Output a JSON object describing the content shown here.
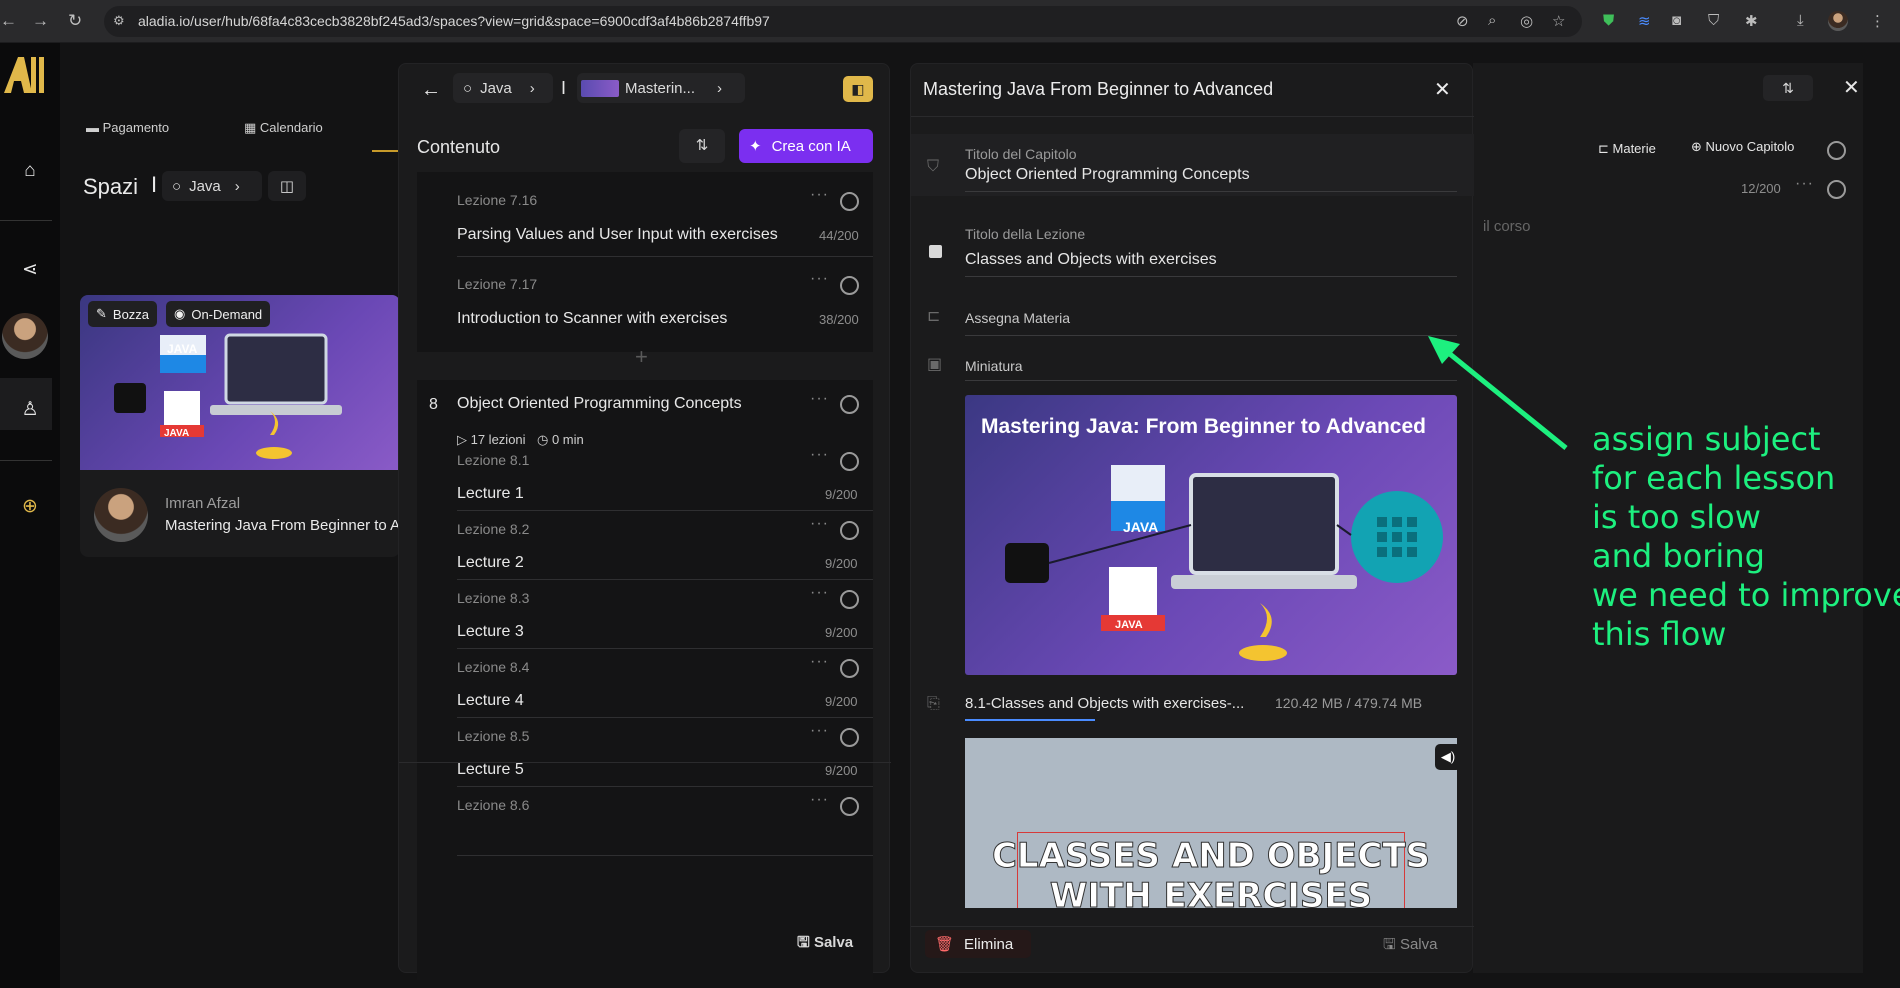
{
  "browser": {
    "url": "aladia.io/user/hub/68fa4c83cecb3828bf245ad3/spaces?view=grid&space=6900cdf3af4b86b2874ffb97"
  },
  "bg": {
    "tabs": [
      "Pagamento",
      "Calendario"
    ],
    "spazi_title": "Spazi",
    "spazi_crumb": "Java",
    "card": {
      "badge1": "Bozza",
      "badge2": "On-Demand",
      "thumb_label": "JAVA",
      "thumb_label2": "JAVA",
      "author": "Imran Afzal",
      "title": "Mastering Java From Beginner to A"
    }
  },
  "mid": {
    "crumb1": "Java",
    "crumb2": "Masterin...",
    "heading": "Contenuto",
    "ai_button": "Crea con IA",
    "lessons_top": [
      {
        "label": "Lezione 7.16",
        "title": "Parsing Values and User Input with exercises",
        "count": "44/200"
      },
      {
        "label": "Lezione 7.17",
        "title": "Introduction to Scanner with exercises",
        "count": "38/200"
      }
    ],
    "chapter": {
      "num": "8",
      "title": "Object Oriented Programming Concepts",
      "lessons_count": "17 lezioni",
      "duration": "0 min"
    },
    "lessons": [
      {
        "label": "Lezione 8.1",
        "title": "Lecture 1",
        "count": "9/200"
      },
      {
        "label": "Lezione 8.2",
        "title": "Lecture 2",
        "count": "9/200"
      },
      {
        "label": "Lezione 8.3",
        "title": "Lecture 3",
        "count": "9/200"
      },
      {
        "label": "Lezione 8.4",
        "title": "Lecture 4",
        "count": "9/200"
      },
      {
        "label": "Lezione 8.5",
        "title": "Lecture 5",
        "count": "9/200"
      },
      {
        "label": "Lezione 8.6",
        "title": "",
        "count": ""
      }
    ],
    "save": "Salva"
  },
  "detail": {
    "title": "Mastering Java From Beginner to Advanced",
    "chapter_label": "Titolo del Capitolo",
    "chapter_value": "Object Oriented Programming Concepts",
    "lesson_label": "Titolo della Lezione",
    "lesson_value": "Classes and Objects with exercises",
    "subject_label": "Assegna Materia",
    "thumb_label": "Miniatura",
    "thumb_title": "Mastering Java: From Beginner to Advanced",
    "thumb_java": "JAVA",
    "thumb_java2": "JAVA",
    "video_file": "8.1-Classes and Objects with exercises-...",
    "video_size": "120.42 MB / 479.74 MB",
    "video_caption_line1": "CLASSES AND OBJECTS",
    "video_caption_line2": "WITH EXERCISES",
    "delete": "Elimina",
    "save": "Salva"
  },
  "farright": {
    "materie": "Materie",
    "nuovo": "Nuovo Capitolo",
    "count": "12/200",
    "ghost_text": "il corso"
  },
  "annotation": {
    "text": "assign subject\nfor each lesson\nis too slow\nand boring\nwe need to improve\nthis flow",
    "color": "#1df07f"
  }
}
